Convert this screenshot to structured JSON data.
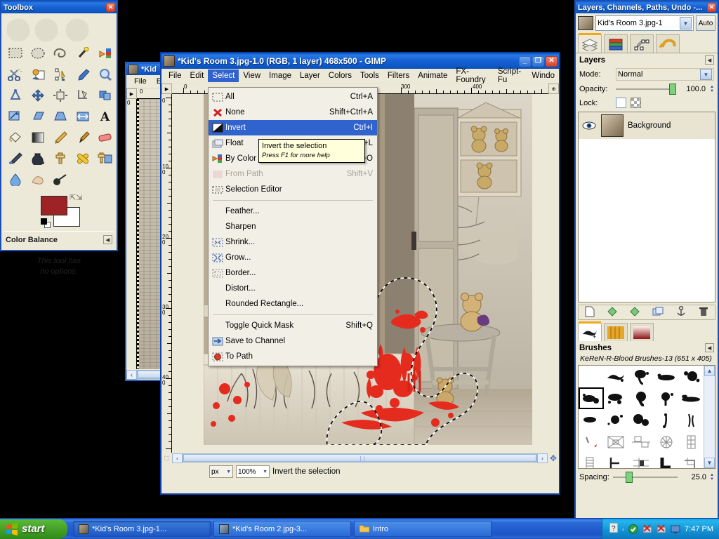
{
  "toolbox": {
    "title": "Toolbox",
    "close_label": "✕",
    "tools": [
      {
        "name": "rect-select-tool",
        "label": "Rectangle Select"
      },
      {
        "name": "ellipse-select-tool",
        "label": "Ellipse Select"
      },
      {
        "name": "free-select-tool",
        "label": "Free Select"
      },
      {
        "name": "fuzzy-select-tool",
        "label": "Fuzzy Select"
      },
      {
        "name": "select-by-color-tool",
        "label": "Select by Color"
      },
      {
        "name": "scissors-select-tool",
        "label": "Scissors Select"
      },
      {
        "name": "foreground-select-tool",
        "label": "Foreground Select"
      },
      {
        "name": "paths-tool",
        "label": "Paths"
      },
      {
        "name": "color-picker-tool",
        "label": "Color Picker"
      },
      {
        "name": "zoom-tool",
        "label": "Zoom"
      },
      {
        "name": "measure-tool",
        "label": "Measure"
      },
      {
        "name": "move-tool",
        "label": "Move"
      },
      {
        "name": "align-tool",
        "label": "Alignment"
      },
      {
        "name": "crop-tool",
        "label": "Crop"
      },
      {
        "name": "rotate-tool",
        "label": "Rotate"
      },
      {
        "name": "scale-tool",
        "label": "Scale"
      },
      {
        "name": "shear-tool",
        "label": "Shear"
      },
      {
        "name": "perspective-tool",
        "label": "Perspective"
      },
      {
        "name": "flip-tool",
        "label": "Flip"
      },
      {
        "name": "text-tool",
        "label": "Text"
      },
      {
        "name": "bucket-fill-tool",
        "label": "Bucket Fill"
      },
      {
        "name": "blend-tool",
        "label": "Blend"
      },
      {
        "name": "pencil-tool",
        "label": "Pencil"
      },
      {
        "name": "paintbrush-tool",
        "label": "Paintbrush"
      },
      {
        "name": "eraser-tool",
        "label": "Eraser"
      },
      {
        "name": "airbrush-tool",
        "label": "Airbrush"
      },
      {
        "name": "ink-tool",
        "label": "Ink"
      },
      {
        "name": "clone-tool",
        "label": "Clone"
      },
      {
        "name": "heal-tool",
        "label": "Heal"
      },
      {
        "name": "perspective-clone-tool",
        "label": "Perspective Clone"
      },
      {
        "name": "blur-sharpen-tool",
        "label": "Blur / Sharpen"
      },
      {
        "name": "smudge-tool",
        "label": "Smudge"
      },
      {
        "name": "dodge-burn-tool",
        "label": "Dodge / Burn"
      }
    ],
    "foreground_color": "#9d2326",
    "background_color": "#ffffff",
    "tool_options_title": "Color Balance",
    "tool_options_body_line1": "This tool has",
    "tool_options_body_line2": "no options."
  },
  "back_window": {
    "title": "*Kid",
    "menus": [
      "File",
      "Ed"
    ]
  },
  "main_window": {
    "title": "*Kid's Room 3.jpg-1.0 (RGB, 1 layer) 468x500 - GIMP",
    "minimize_label": "_",
    "maximize_label": "❐",
    "close_label": "✕",
    "menus": [
      "File",
      "Edit",
      "Select",
      "View",
      "Image",
      "Layer",
      "Colors",
      "Tools",
      "Filters",
      "Animate",
      "FX-Foundry",
      "Script-Fu",
      "Windo"
    ],
    "active_menu": "Select",
    "ruler_h_labels": [
      "0",
      "300",
      "400"
    ],
    "ruler_v_labels": [
      "0",
      "100",
      "200",
      "300",
      "400"
    ],
    "statusbar": {
      "unit": "px",
      "zoom": "100%",
      "message": "Invert the selection"
    }
  },
  "select_menu": {
    "items": [
      {
        "label": "All",
        "accel": "Ctrl+A",
        "icon": "select-all-icon",
        "state": "normal"
      },
      {
        "label": "None",
        "accel": "Shift+Ctrl+A",
        "icon": "select-none-icon",
        "state": "normal"
      },
      {
        "label": "Invert",
        "accel": "Ctrl+I",
        "icon": "select-invert-icon",
        "state": "highlighted"
      },
      {
        "label": "Float",
        "accel": "Shift+Ctrl+L",
        "icon": "select-float-icon",
        "state": "normal"
      },
      {
        "label": "By Color",
        "accel": "Shift+O",
        "icon": "select-by-color-icon",
        "state": "normal"
      },
      {
        "label": "From Path",
        "accel": "Shift+V",
        "icon": "from-path-icon",
        "state": "disabled"
      },
      {
        "label": "Selection Editor",
        "accel": "",
        "icon": "selection-editor-icon",
        "state": "normal"
      },
      {
        "separator": true
      },
      {
        "label": "Feather...",
        "accel": "",
        "icon": "",
        "state": "normal"
      },
      {
        "label": "Sharpen",
        "accel": "",
        "icon": "",
        "state": "normal"
      },
      {
        "label": "Shrink...",
        "accel": "",
        "icon": "shrink-icon",
        "state": "normal"
      },
      {
        "label": "Grow...",
        "accel": "",
        "icon": "grow-icon",
        "state": "normal"
      },
      {
        "label": "Border...",
        "accel": "",
        "icon": "border-icon",
        "state": "normal"
      },
      {
        "label": "Distort...",
        "accel": "",
        "icon": "",
        "state": "normal"
      },
      {
        "label": "Rounded Rectangle...",
        "accel": "",
        "icon": "",
        "state": "normal"
      },
      {
        "separator": true
      },
      {
        "label": "Toggle Quick Mask",
        "accel": "Shift+Q",
        "icon": "",
        "state": "normal"
      },
      {
        "label": "Save to Channel",
        "accel": "",
        "icon": "save-to-channel-icon",
        "state": "normal"
      },
      {
        "label": "To Path",
        "accel": "",
        "icon": "to-path-icon",
        "state": "normal"
      }
    ]
  },
  "tooltip": {
    "text": "Invert the selection",
    "hint": "Press F1 for more help"
  },
  "dock": {
    "title": "Layers, Channels, Paths, Undo -...",
    "close_label": "✕",
    "image_name": "Kid's Room 3.jpg-1",
    "auto_label": "Auto",
    "tabs": [
      {
        "name": "layers-tab",
        "label": "Layers"
      },
      {
        "name": "channels-tab",
        "label": "Channels"
      },
      {
        "name": "paths-tab",
        "label": "Paths"
      },
      {
        "name": "undo-tab",
        "label": "Undo History"
      }
    ],
    "layers_panel": {
      "title": "Layers",
      "mode_label": "Mode:",
      "mode_value": "Normal",
      "opacity_label": "Opacity:",
      "opacity_value": "100.0",
      "lock_label": "Lock:",
      "layers": [
        {
          "name": "Background",
          "visible": true
        }
      ],
      "buttons": [
        {
          "name": "new-layer-button",
          "label": "New Layer"
        },
        {
          "name": "raise-layer-button",
          "label": "Raise Layer"
        },
        {
          "name": "lower-layer-button",
          "label": "Lower Layer"
        },
        {
          "name": "duplicate-layer-button",
          "label": "Duplicate Layer"
        },
        {
          "name": "anchor-layer-button",
          "label": "Anchor Layer"
        },
        {
          "name": "delete-layer-button",
          "label": "Delete Layer"
        }
      ]
    },
    "brushes_panel": {
      "tabs": [
        {
          "name": "brushes-tab",
          "label": "Brushes"
        },
        {
          "name": "patterns-tab",
          "label": "Patterns"
        },
        {
          "name": "gradients-tab",
          "label": "Gradients"
        }
      ],
      "title": "Brushes",
      "selected_brush": "KeReN-R-Blood Brushes-13 (651 x 405)",
      "spacing_label": "Spacing:",
      "spacing_value": "25.0"
    }
  },
  "taskbar": {
    "start_label": "start",
    "buttons": [
      {
        "name": "taskbar-kids-room-3",
        "label": "*Kid's Room 3.jpg-1...",
        "active": true
      },
      {
        "name": "taskbar-kids-room-2",
        "label": "*Kid's Room 2.jpg-3...",
        "active": false
      },
      {
        "name": "taskbar-intro",
        "label": "Intro",
        "active": false
      }
    ],
    "clock": "7:47 PM"
  }
}
